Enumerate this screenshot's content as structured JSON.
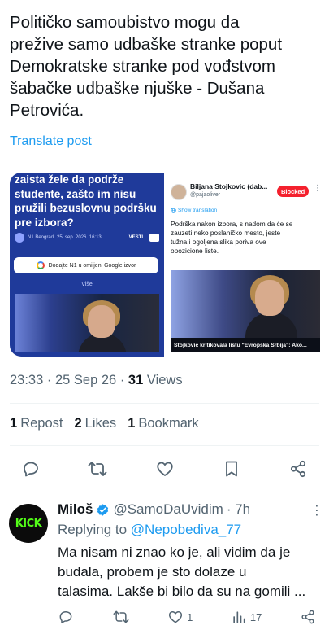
{
  "post": {
    "text": "Političko samoubistvo mogu da\npreživе samo udbaške stranke poput\nDemokratske stranke pod vođstvom\nšabačke udbaške njuške - Dušana\nPetrovića.",
    "translate_label": "Translate post"
  },
  "media": {
    "left": {
      "headline": "zaista žele da podrže\nstudente, zašto im nisu\npružili bezuslovnu podršku\npre izbora?",
      "source": "N1 Beograd",
      "date": "25. sep. 2026. 16:13",
      "tag": "VESTI",
      "google_button": "Dodajte N1 u omiljeni Google izvor",
      "more_label": "Više"
    },
    "right": {
      "name": "Biljana Stojkovic (dab...",
      "handle": "@pajaoliver",
      "blocked_label": "Blocked",
      "more_icon": "⋮",
      "show_translation": "Show translation",
      "text": "Podrška nakon izbora, s nadom da će se\nzauzeti neko poslaničko mesto, jeste\ntužna i ogoljena slika poriva ove\nopozicione liste.",
      "caption": "Stojković kritikovala listu \"Evropska Srbija\": Ako..."
    }
  },
  "meta": {
    "time": "23:33",
    "date": "25 Sep 26",
    "views_count": "31",
    "views_label": "Views"
  },
  "stats": {
    "reposts_count": "1",
    "reposts_label": "Repost",
    "likes_count": "2",
    "likes_label": "Likes",
    "bookmarks_count": "1",
    "bookmarks_label": "Bookmark"
  },
  "reply": {
    "avatar_text": "KICK",
    "name": "Miloš",
    "handle": "@SamoDaUvidim",
    "time": "· 7h",
    "more_icon": "⋮",
    "replying_prefix": "Replying to ",
    "replying_handle": "@Nepobediva_77",
    "text": "Ma nisam ni znao ko je, ali vidim da je\nbudala, probem je sto dolaze u\ntalasima. Lakše bi bilo da su na gomili ...",
    "likes": "1",
    "views": "17"
  },
  "colors": {
    "accent": "#1d9bf0",
    "blocked": "#f4212e",
    "kick_green": "#53fc18",
    "muted": "#536471"
  },
  "icons": [
    "reply-icon",
    "repost-icon",
    "like-icon",
    "bookmark-icon",
    "share-icon",
    "verified-icon",
    "views-icon"
  ]
}
